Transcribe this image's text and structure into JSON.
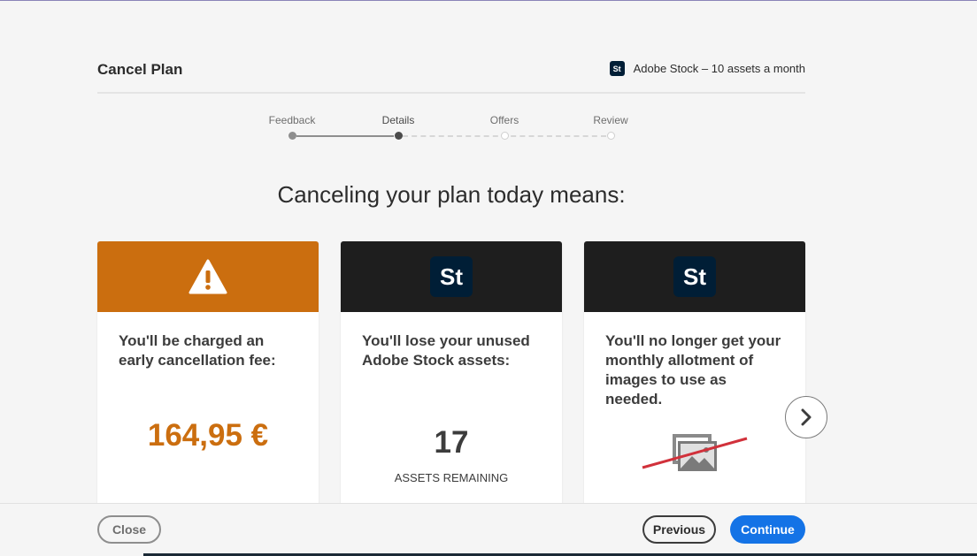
{
  "header": {
    "title": "Cancel Plan",
    "product_icon_text": "St",
    "product_label": "Adobe Stock – 10 assets a month"
  },
  "stepper": {
    "steps": [
      {
        "label": "Feedback",
        "state": "done"
      },
      {
        "label": "Details",
        "state": "current"
      },
      {
        "label": "Offers",
        "state": "future"
      },
      {
        "label": "Review",
        "state": "future"
      }
    ]
  },
  "headline": "Canceling your plan today means:",
  "cards": [
    {
      "icon": "warning-icon",
      "header_color": "#cb6e0f",
      "text": "You'll be charged an early cancellation fee:",
      "value": "164,95 €"
    },
    {
      "icon": "st-logo",
      "icon_text": "St",
      "header_color": "#1e1e1e",
      "text": "You'll lose your unused Adobe Stock assets:",
      "value": "17",
      "value_label": "ASSETS REMAINING"
    },
    {
      "icon": "st-logo",
      "icon_text": "St",
      "header_color": "#1e1e1e",
      "text": "You'll no longer get your monthly allotment of images to use as needed.",
      "illustration": "crossed-out-images-icon"
    }
  ],
  "next_icon": "chevron-right-icon",
  "footer": {
    "close_label": "Close",
    "previous_label": "Previous",
    "continue_label": "Continue"
  },
  "colors": {
    "accent": "#1473e6",
    "warning": "#cb6e0f",
    "stock_brand": "#001e36"
  }
}
